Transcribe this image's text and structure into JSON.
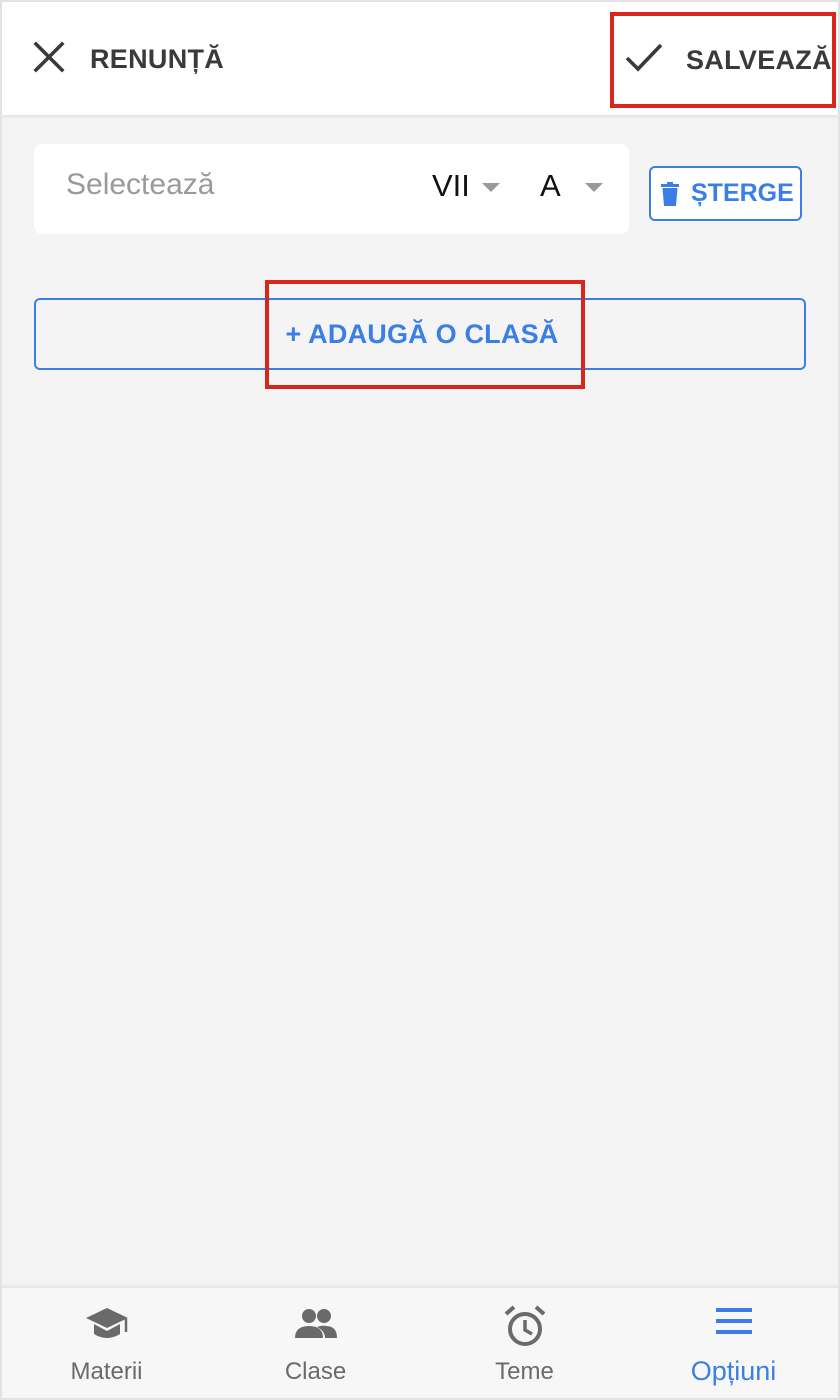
{
  "header": {
    "cancel_label": "RENUNȚĂ",
    "cancel_icon": "close-icon",
    "save_label": "SALVEAZĂ",
    "save_icon": "check-icon"
  },
  "class_row": {
    "subject_placeholder": "Selectează",
    "grade_value": "VII",
    "letter_value": "A",
    "delete_label": "ȘTERGE",
    "delete_icon": "trash-icon"
  },
  "add_class_label": "+ ADAUGĂ O CLASĂ",
  "bottom_nav": {
    "items": [
      {
        "label": "Materii",
        "icon": "graduation-cap-icon",
        "active": false
      },
      {
        "label": "Clase",
        "icon": "people-icon",
        "active": false
      },
      {
        "label": "Teme",
        "icon": "alarm-clock-icon",
        "active": false
      },
      {
        "label": "Opțiuni",
        "icon": "menu-icon",
        "active": true
      }
    ]
  },
  "colors": {
    "accent": "#3b7fe5",
    "highlight": "#d9261c",
    "text_dark": "#3a3a3a",
    "muted": "#9a9a9a",
    "background": "#f4f4f4"
  }
}
